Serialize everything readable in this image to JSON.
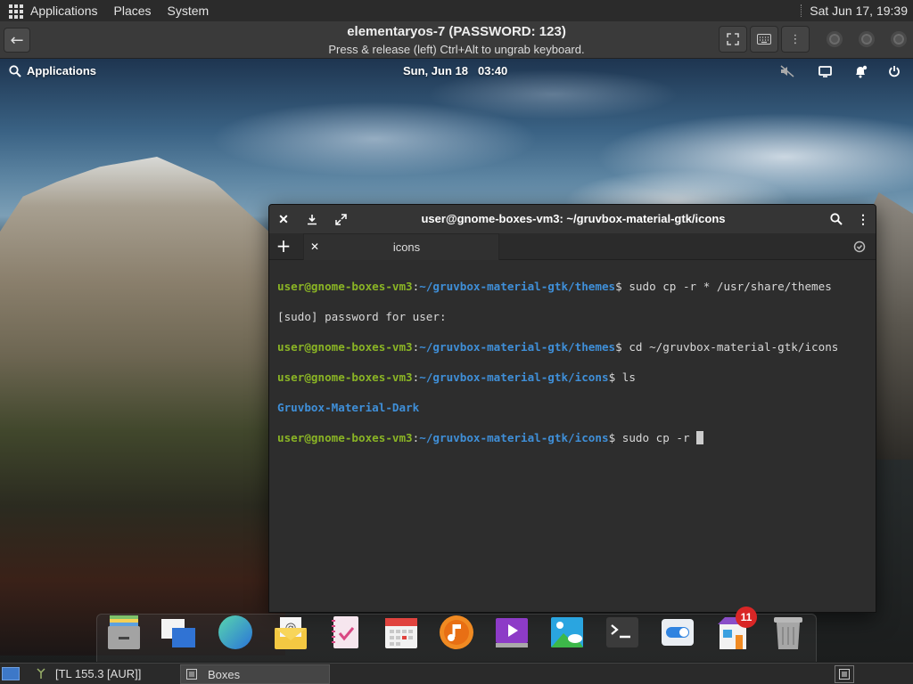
{
  "host_panel": {
    "menus": [
      "Applications",
      "Places",
      "System"
    ],
    "clock": "Sat Jun 17, 19:39"
  },
  "boxes_header": {
    "title": "elementaryos-7 (PASSWORD: 123)",
    "subtitle": "Press & release (left) Ctrl+Alt to ungrab keyboard."
  },
  "guest_panel": {
    "applications_label": "Applications",
    "date": "Sun, Jun 18",
    "time": "03:40"
  },
  "terminal": {
    "title": "user@gnome-boxes-vm3: ~/gruvbox-material-gtk/icons",
    "tab_label": "icons",
    "lines": [
      {
        "user": "user@gnome-boxes-vm3",
        "path": "~/gruvbox-material-gtk/themes",
        "cmd": " sudo cp -r * /usr/share/themes"
      },
      {
        "text": "[sudo] password for user:"
      },
      {
        "user": "user@gnome-boxes-vm3",
        "path": "~/gruvbox-material-gtk/themes",
        "cmd": " cd ~/gruvbox-material-gtk/icons"
      },
      {
        "user": "user@gnome-boxes-vm3",
        "path": "~/gruvbox-material-gtk/icons",
        "cmd": " ls"
      },
      {
        "dir": "Gruvbox-Material-Dark"
      },
      {
        "user": "user@gnome-boxes-vm3",
        "path": "~/gruvbox-material-gtk/icons",
        "cmd": " sudo cp -r ",
        "cursor": true
      }
    ]
  },
  "dock": {
    "items": [
      "files",
      "multitasking-view",
      "web-browser",
      "mail",
      "tasks",
      "calendar",
      "music",
      "videos",
      "photos",
      "terminal",
      "system-settings",
      "app-center",
      "trash"
    ],
    "app_center_badge": "11"
  },
  "host_taskbar": {
    "weather": "[TL 155.3 [AUR]]",
    "task_label": "Boxes"
  }
}
